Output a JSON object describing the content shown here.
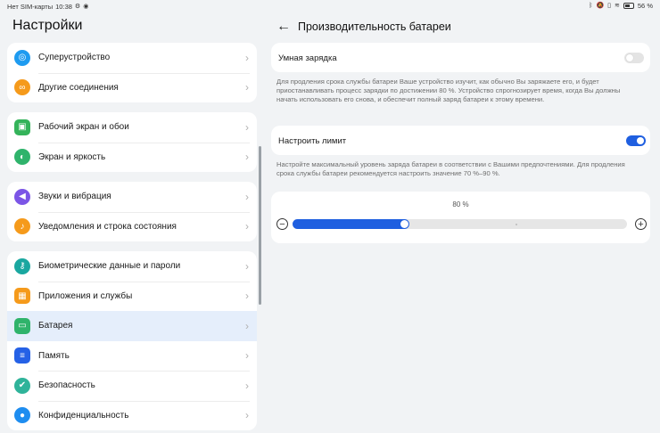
{
  "status_bar": {
    "carrier": "Нет SIM-карты",
    "time": "10:38",
    "battery_pct": "56 %"
  },
  "colors": {
    "accent": "#1f5fe0",
    "selected_bg": "#e5eefb",
    "background": "#f1f3f5"
  },
  "sidebar": {
    "title": "Настройки",
    "groups": [
      {
        "items": [
          {
            "label": "Суперустройство",
            "icon": "superdevice-icon",
            "color": "#1e9bf0"
          },
          {
            "label": "Другие соединения",
            "icon": "link-icon",
            "color": "#f59a1b"
          }
        ]
      },
      {
        "items": [
          {
            "label": "Рабочий экран и обои",
            "icon": "wallpaper-icon",
            "color": "#34b35a"
          },
          {
            "label": "Экран и яркость",
            "icon": "display-icon",
            "color": "#2fb36b"
          }
        ]
      },
      {
        "items": [
          {
            "label": "Звуки и вибрация",
            "icon": "sound-icon",
            "color": "#7b55e6"
          },
          {
            "label": "Уведомления и строка состояния",
            "icon": "bell-icon",
            "color": "#f59a1b"
          }
        ]
      },
      {
        "items": [
          {
            "label": "Биометрические данные и пароли",
            "icon": "key-icon",
            "color": "#1aa7a0"
          },
          {
            "label": "Приложения и службы",
            "icon": "apps-icon",
            "color": "#f59a1b"
          },
          {
            "label": "Батарея",
            "icon": "battery-icon",
            "color": "#2fb36b",
            "selected": true
          },
          {
            "label": "Память",
            "icon": "storage-icon",
            "color": "#2561e6"
          },
          {
            "label": "Безопасность",
            "icon": "shield-icon",
            "color": "#2fb39a"
          },
          {
            "label": "Конфиденциальность",
            "icon": "privacy-icon",
            "color": "#1e8df0"
          }
        ]
      }
    ]
  },
  "main": {
    "title": "Производительность батареи",
    "smart_charge": {
      "label": "Умная зарядка",
      "enabled": false,
      "description": "Для продления срока службы батареи Ваше устройство изучит, как обычно Вы заряжаете его, и будет приостанавливать процесс зарядки по достижении 80 %. Устройство спрогнозирует время, когда Вы должны начать использовать его снова, и обеспечит полный заряд батареи к этому времени."
    },
    "limit": {
      "label": "Настроить лимит",
      "enabled": true,
      "description": "Настройте максимальный уровень заряда батареи в соответствии с Вашими предпочтениями. Для продления срока службы батареи рекомендуется настроить значение 70 %–90 %."
    },
    "slider": {
      "value_label": "80 %",
      "value": 80,
      "min": 70,
      "max": 90,
      "fill_fraction": 0.35,
      "minus_icon": "minus-circle-icon",
      "plus_icon": "plus-circle-icon"
    }
  }
}
